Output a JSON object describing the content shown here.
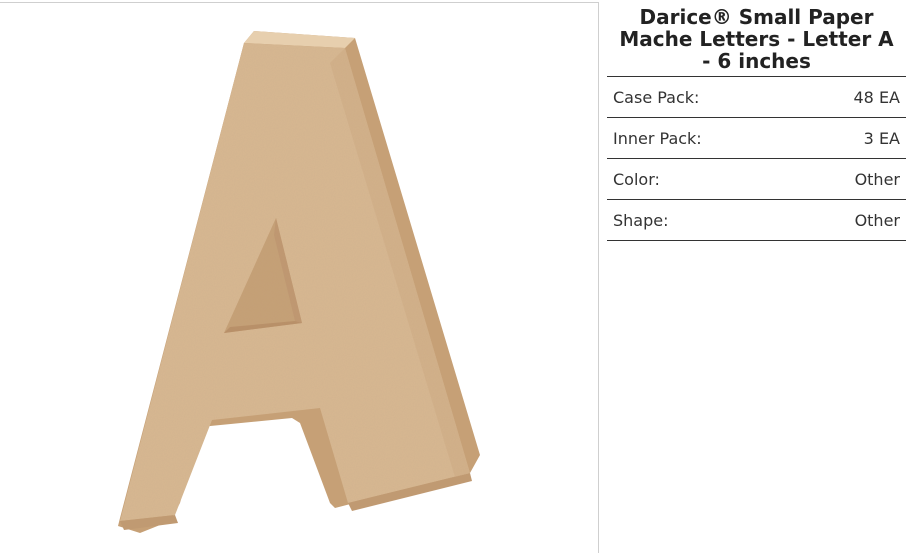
{
  "product": {
    "title": "Darice® Small Paper Mache Letters - Letter A - 6 inches",
    "image_alt": "paper mache letter A"
  },
  "specs": [
    {
      "label": "Case Pack:",
      "value": "48 EA"
    },
    {
      "label": "Inner Pack:",
      "value": "3 EA"
    },
    {
      "label": "Color:",
      "value": "Other"
    },
    {
      "label": "Shape:",
      "value": "Other"
    }
  ],
  "colors": {
    "cardboard_face": "#d9b993",
    "cardboard_side": "#c9a47c",
    "cardboard_top": "#e6cca9",
    "divider": "#333333"
  }
}
